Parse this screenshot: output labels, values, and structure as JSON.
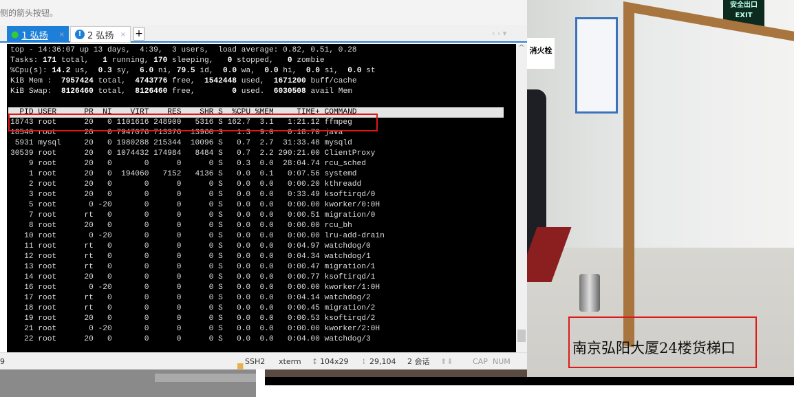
{
  "hint_text": "侧的箭头按钮。",
  "tabs": [
    {
      "label": "1 弘扬",
      "active": true,
      "status_icon": "green-dot-icon"
    },
    {
      "label": "2 弘扬",
      "active": false,
      "status_icon": "info-icon"
    }
  ],
  "tab_close": "×",
  "tab_add": "+",
  "tab_nav": "‹ ›  ▾",
  "summary": [
    [
      [
        "top - 14:36:07 up 13 days,  4:39,  3 users,  load average: 0.82, 0.51, 0.28",
        0
      ]
    ],
    [
      [
        "Tasks: ",
        0
      ],
      [
        "171",
        1
      ],
      [
        " total,   ",
        0
      ],
      [
        "1",
        1
      ],
      [
        " running, ",
        0
      ],
      [
        "170",
        1
      ],
      [
        " sleeping,   ",
        0
      ],
      [
        "0",
        1
      ],
      [
        " stopped,   ",
        0
      ],
      [
        "0",
        1
      ],
      [
        " zombie",
        0
      ]
    ],
    [
      [
        "%Cpu(s): ",
        0
      ],
      [
        "14.2",
        1
      ],
      [
        " us,  ",
        0
      ],
      [
        "0.3",
        1
      ],
      [
        " sy,  ",
        0
      ],
      [
        "6.0",
        1
      ],
      [
        " ni, ",
        0
      ],
      [
        "79.5",
        1
      ],
      [
        " id,  ",
        0
      ],
      [
        "0.0",
        1
      ],
      [
        " wa,  ",
        0
      ],
      [
        "0.0",
        1
      ],
      [
        " hi,  ",
        0
      ],
      [
        "0.0",
        1
      ],
      [
        " si,  ",
        0
      ],
      [
        "0.0",
        1
      ],
      [
        " st",
        0
      ]
    ],
    [
      [
        "KiB Mem :  ",
        0
      ],
      [
        "7957424",
        1
      ],
      [
        " total,  ",
        0
      ],
      [
        "4743776",
        1
      ],
      [
        " free,  ",
        0
      ],
      [
        "1542448",
        1
      ],
      [
        " used,  ",
        0
      ],
      [
        "1671200",
        1
      ],
      [
        " buff/cache",
        0
      ]
    ],
    [
      [
        "KiB Swap:  ",
        0
      ],
      [
        "8126460",
        1
      ],
      [
        " total,  ",
        0
      ],
      [
        "8126460",
        1
      ],
      [
        " free,        ",
        0
      ],
      [
        "0",
        1
      ],
      [
        " used.  ",
        0
      ],
      [
        "6030508",
        1
      ],
      [
        " avail Mem",
        0
      ]
    ]
  ],
  "columns": [
    "PID",
    "USER",
    "PR",
    "NI",
    "VIRT",
    "RES",
    "SHR",
    "S",
    "%CPU",
    "%MEM",
    "TIME+",
    "COMMAND"
  ],
  "processes": [
    [
      "18743",
      "root",
      "20",
      "0",
      "1101616",
      "248900",
      "5316",
      "S",
      "162.7",
      "3.1",
      "1:21.12",
      "ffmpeg"
    ],
    [
      "18540",
      "root",
      "20",
      "0",
      "7947076",
      "713376",
      "13960",
      "S",
      "1.3",
      "9.0",
      "0:18.70",
      "java"
    ],
    [
      "5931",
      "mysql",
      "20",
      "0",
      "1980288",
      "215344",
      "10096",
      "S",
      "0.7",
      "2.7",
      "31:33.48",
      "mysqld"
    ],
    [
      "30539",
      "root",
      "20",
      "0",
      "1074432",
      "174984",
      "8484",
      "S",
      "0.7",
      "2.2",
      "290:21.00",
      "ClientProxy"
    ],
    [
      "9",
      "root",
      "20",
      "0",
      "0",
      "0",
      "0",
      "S",
      "0.3",
      "0.0",
      "28:04.74",
      "rcu_sched"
    ],
    [
      "1",
      "root",
      "20",
      "0",
      "194060",
      "7152",
      "4136",
      "S",
      "0.0",
      "0.1",
      "0:07.56",
      "systemd"
    ],
    [
      "2",
      "root",
      "20",
      "0",
      "0",
      "0",
      "0",
      "S",
      "0.0",
      "0.0",
      "0:00.20",
      "kthreadd"
    ],
    [
      "3",
      "root",
      "20",
      "0",
      "0",
      "0",
      "0",
      "S",
      "0.0",
      "0.0",
      "0:33.49",
      "ksoftirqd/0"
    ],
    [
      "5",
      "root",
      "0",
      "-20",
      "0",
      "0",
      "0",
      "S",
      "0.0",
      "0.0",
      "0:00.00",
      "kworker/0:0H"
    ],
    [
      "7",
      "root",
      "rt",
      "0",
      "0",
      "0",
      "0",
      "S",
      "0.0",
      "0.0",
      "0:00.51",
      "migration/0"
    ],
    [
      "8",
      "root",
      "20",
      "0",
      "0",
      "0",
      "0",
      "S",
      "0.0",
      "0.0",
      "0:00.00",
      "rcu_bh"
    ],
    [
      "10",
      "root",
      "0",
      "-20",
      "0",
      "0",
      "0",
      "S",
      "0.0",
      "0.0",
      "0:00.00",
      "lru-add-drain"
    ],
    [
      "11",
      "root",
      "rt",
      "0",
      "0",
      "0",
      "0",
      "S",
      "0.0",
      "0.0",
      "0:04.97",
      "watchdog/0"
    ],
    [
      "12",
      "root",
      "rt",
      "0",
      "0",
      "0",
      "0",
      "S",
      "0.0",
      "0.0",
      "0:04.34",
      "watchdog/1"
    ],
    [
      "13",
      "root",
      "rt",
      "0",
      "0",
      "0",
      "0",
      "S",
      "0.0",
      "0.0",
      "0:00.47",
      "migration/1"
    ],
    [
      "14",
      "root",
      "20",
      "0",
      "0",
      "0",
      "0",
      "S",
      "0.0",
      "0.0",
      "0:00.77",
      "ksoftirqd/1"
    ],
    [
      "16",
      "root",
      "0",
      "-20",
      "0",
      "0",
      "0",
      "S",
      "0.0",
      "0.0",
      "0:00.00",
      "kworker/1:0H"
    ],
    [
      "17",
      "root",
      "rt",
      "0",
      "0",
      "0",
      "0",
      "S",
      "0.0",
      "0.0",
      "0:04.14",
      "watchdog/2"
    ],
    [
      "18",
      "root",
      "rt",
      "0",
      "0",
      "0",
      "0",
      "S",
      "0.0",
      "0.0",
      "0:00.45",
      "migration/2"
    ],
    [
      "19",
      "root",
      "20",
      "0",
      "0",
      "0",
      "0",
      "S",
      "0.0",
      "0.0",
      "0:00.53",
      "ksoftirqd/2"
    ],
    [
      "21",
      "root",
      "0",
      "-20",
      "0",
      "0",
      "0",
      "S",
      "0.0",
      "0.0",
      "0:00.00",
      "kworker/2:0H"
    ],
    [
      "22",
      "root",
      "20",
      "0",
      "0",
      "0",
      "0",
      "S",
      "0.0",
      "0.0",
      "0:04.00",
      "watchdog/3"
    ]
  ],
  "status": {
    "left": "9",
    "protocol": "SSH2",
    "term": "xterm",
    "size": "104x29",
    "cursor": "29,104",
    "sessions": "2 会话",
    "cap": "CAP",
    "num": "NUM"
  },
  "video": {
    "caption": "南京弘阳大厦24楼货梯口",
    "exit_sign": "安全出口 EXIT",
    "hydrant_sign": "消火栓"
  },
  "colors": {
    "accent": "#1e7fd8",
    "highlight_box": "#e01818"
  }
}
